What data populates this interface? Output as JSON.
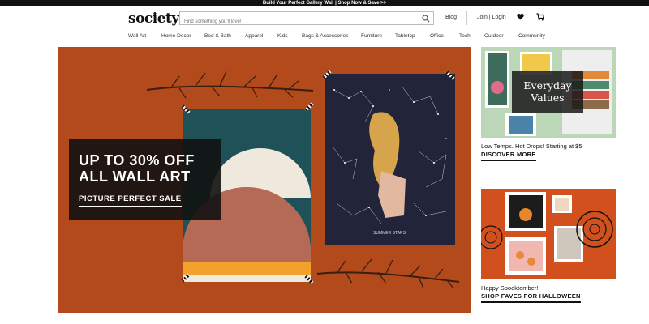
{
  "promo": {
    "text": "Build Your Perfect Gallery Wall | Shop Now & Save >>"
  },
  "header": {
    "logo": "society6",
    "search_placeholder": "Find something you'll love!",
    "blog": "Blog",
    "login": "Join | Login"
  },
  "nav": {
    "items": [
      "Wall Art",
      "Home Decor",
      "Bed & Bath",
      "Apparel",
      "Kids",
      "Bags & Accessories",
      "Furniture",
      "Tabletop",
      "Office",
      "Tech",
      "Outdoor",
      "Community"
    ]
  },
  "hero": {
    "headline_line1": "UP TO 30% OFF",
    "headline_line2": "ALL WALL ART",
    "cta": "PICTURE PERFECT SALE",
    "poster_caption": "SUMMER STARS"
  },
  "promo_cards": [
    {
      "overlay_line1": "Everyday",
      "overlay_line2": "Values",
      "caption": "Low Temps. Hot Drops! Starting at $5",
      "link": "DISCOVER MORE"
    },
    {
      "caption": "Happy Spooktember!",
      "link": "SHOP FAVES FOR HALLOWEEN"
    }
  ],
  "colors": {
    "hero_bg": "#b34a1c",
    "promo_bar": "#111111",
    "card_overlay": "#191919"
  }
}
